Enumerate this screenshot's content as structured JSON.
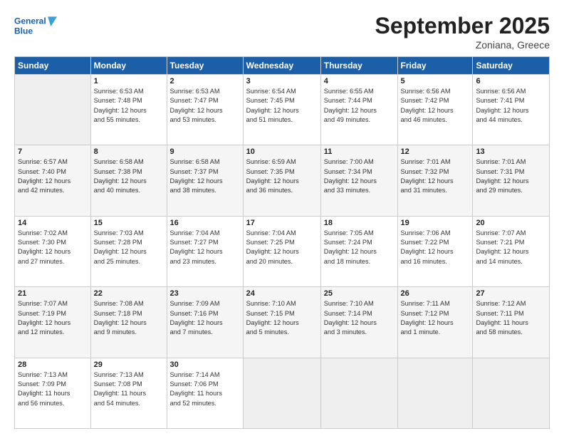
{
  "header": {
    "logo_line1": "General",
    "logo_line2": "Blue",
    "month": "September 2025",
    "location": "Zoniana, Greece"
  },
  "days_of_week": [
    "Sunday",
    "Monday",
    "Tuesday",
    "Wednesday",
    "Thursday",
    "Friday",
    "Saturday"
  ],
  "weeks": [
    [
      {
        "day": "",
        "info": ""
      },
      {
        "day": "1",
        "info": "Sunrise: 6:53 AM\nSunset: 7:48 PM\nDaylight: 12 hours\nand 55 minutes."
      },
      {
        "day": "2",
        "info": "Sunrise: 6:53 AM\nSunset: 7:47 PM\nDaylight: 12 hours\nand 53 minutes."
      },
      {
        "day": "3",
        "info": "Sunrise: 6:54 AM\nSunset: 7:45 PM\nDaylight: 12 hours\nand 51 minutes."
      },
      {
        "day": "4",
        "info": "Sunrise: 6:55 AM\nSunset: 7:44 PM\nDaylight: 12 hours\nand 49 minutes."
      },
      {
        "day": "5",
        "info": "Sunrise: 6:56 AM\nSunset: 7:42 PM\nDaylight: 12 hours\nand 46 minutes."
      },
      {
        "day": "6",
        "info": "Sunrise: 6:56 AM\nSunset: 7:41 PM\nDaylight: 12 hours\nand 44 minutes."
      }
    ],
    [
      {
        "day": "7",
        "info": "Sunrise: 6:57 AM\nSunset: 7:40 PM\nDaylight: 12 hours\nand 42 minutes."
      },
      {
        "day": "8",
        "info": "Sunrise: 6:58 AM\nSunset: 7:38 PM\nDaylight: 12 hours\nand 40 minutes."
      },
      {
        "day": "9",
        "info": "Sunrise: 6:58 AM\nSunset: 7:37 PM\nDaylight: 12 hours\nand 38 minutes."
      },
      {
        "day": "10",
        "info": "Sunrise: 6:59 AM\nSunset: 7:35 PM\nDaylight: 12 hours\nand 36 minutes."
      },
      {
        "day": "11",
        "info": "Sunrise: 7:00 AM\nSunset: 7:34 PM\nDaylight: 12 hours\nand 33 minutes."
      },
      {
        "day": "12",
        "info": "Sunrise: 7:01 AM\nSunset: 7:32 PM\nDaylight: 12 hours\nand 31 minutes."
      },
      {
        "day": "13",
        "info": "Sunrise: 7:01 AM\nSunset: 7:31 PM\nDaylight: 12 hours\nand 29 minutes."
      }
    ],
    [
      {
        "day": "14",
        "info": "Sunrise: 7:02 AM\nSunset: 7:30 PM\nDaylight: 12 hours\nand 27 minutes."
      },
      {
        "day": "15",
        "info": "Sunrise: 7:03 AM\nSunset: 7:28 PM\nDaylight: 12 hours\nand 25 minutes."
      },
      {
        "day": "16",
        "info": "Sunrise: 7:04 AM\nSunset: 7:27 PM\nDaylight: 12 hours\nand 23 minutes."
      },
      {
        "day": "17",
        "info": "Sunrise: 7:04 AM\nSunset: 7:25 PM\nDaylight: 12 hours\nand 20 minutes."
      },
      {
        "day": "18",
        "info": "Sunrise: 7:05 AM\nSunset: 7:24 PM\nDaylight: 12 hours\nand 18 minutes."
      },
      {
        "day": "19",
        "info": "Sunrise: 7:06 AM\nSunset: 7:22 PM\nDaylight: 12 hours\nand 16 minutes."
      },
      {
        "day": "20",
        "info": "Sunrise: 7:07 AM\nSunset: 7:21 PM\nDaylight: 12 hours\nand 14 minutes."
      }
    ],
    [
      {
        "day": "21",
        "info": "Sunrise: 7:07 AM\nSunset: 7:19 PM\nDaylight: 12 hours\nand 12 minutes."
      },
      {
        "day": "22",
        "info": "Sunrise: 7:08 AM\nSunset: 7:18 PM\nDaylight: 12 hours\nand 9 minutes."
      },
      {
        "day": "23",
        "info": "Sunrise: 7:09 AM\nSunset: 7:16 PM\nDaylight: 12 hours\nand 7 minutes."
      },
      {
        "day": "24",
        "info": "Sunrise: 7:10 AM\nSunset: 7:15 PM\nDaylight: 12 hours\nand 5 minutes."
      },
      {
        "day": "25",
        "info": "Sunrise: 7:10 AM\nSunset: 7:14 PM\nDaylight: 12 hours\nand 3 minutes."
      },
      {
        "day": "26",
        "info": "Sunrise: 7:11 AM\nSunset: 7:12 PM\nDaylight: 12 hours\nand 1 minute."
      },
      {
        "day": "27",
        "info": "Sunrise: 7:12 AM\nSunset: 7:11 PM\nDaylight: 11 hours\nand 58 minutes."
      }
    ],
    [
      {
        "day": "28",
        "info": "Sunrise: 7:13 AM\nSunset: 7:09 PM\nDaylight: 11 hours\nand 56 minutes."
      },
      {
        "day": "29",
        "info": "Sunrise: 7:13 AM\nSunset: 7:08 PM\nDaylight: 11 hours\nand 54 minutes."
      },
      {
        "day": "30",
        "info": "Sunrise: 7:14 AM\nSunset: 7:06 PM\nDaylight: 11 hours\nand 52 minutes."
      },
      {
        "day": "",
        "info": ""
      },
      {
        "day": "",
        "info": ""
      },
      {
        "day": "",
        "info": ""
      },
      {
        "day": "",
        "info": ""
      }
    ]
  ]
}
